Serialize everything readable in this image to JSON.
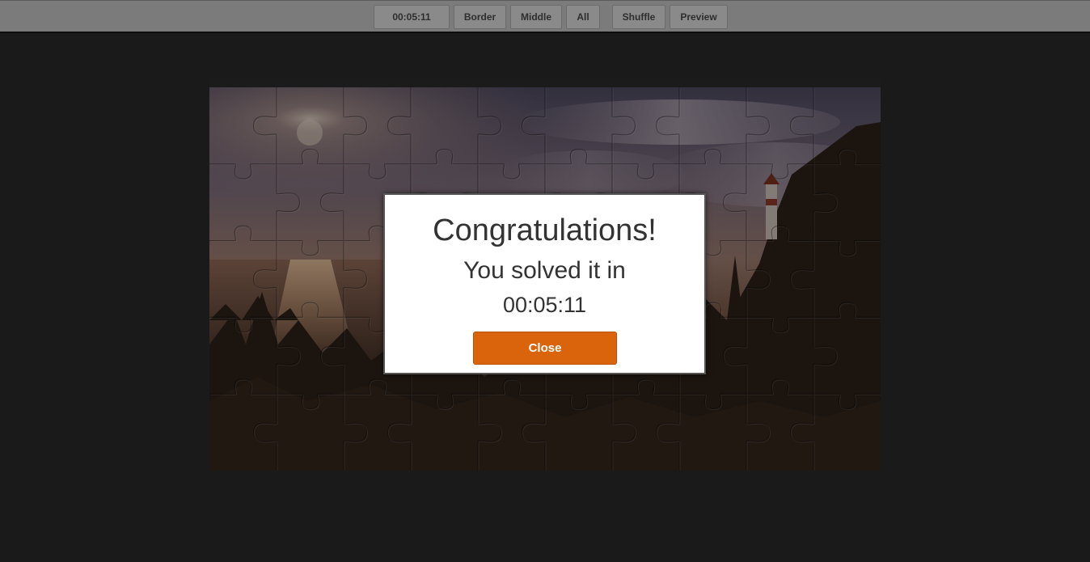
{
  "toolbar": {
    "timer": "00:05:11",
    "border_label": "Border",
    "middle_label": "Middle",
    "all_label": "All",
    "shuffle_label": "Shuffle",
    "preview_label": "Preview"
  },
  "puzzle": {
    "columns": 10,
    "rows": 5,
    "state": "solved",
    "image_icon": "sunset-lighthouse-landscape"
  },
  "dialog": {
    "title": "Congratulations!",
    "message": "You solved it in",
    "time": "00:05:11",
    "close_label": "Close"
  },
  "colors": {
    "accent": "#d9640b",
    "toolbar_bg": "#7b7b7b",
    "page_bg": "#1a1a1a",
    "dialog_bg": "#ffffff"
  }
}
